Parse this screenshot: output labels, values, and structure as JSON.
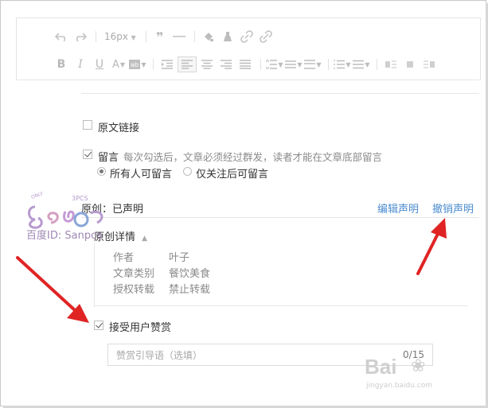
{
  "toolbar": {
    "font_size": "16px",
    "row1_icons": [
      "undo-icon",
      "redo-icon",
      "quote-icon",
      "horizontal-rule-icon",
      "format-painter-icon",
      "clear-format-icon",
      "link-icon",
      "unlink-icon"
    ],
    "row2_icons": [
      "bold-icon",
      "italic-icon",
      "underline-icon",
      "font-color-icon",
      "background-color-icon",
      "indent-icon",
      "align-left-icon",
      "align-center-icon",
      "align-right-icon",
      "align-justify-icon",
      "line-height-icon",
      "letter-spacing-icon",
      "paragraph-spacing-icon",
      "ordered-list-icon",
      "unordered-list-icon",
      "float-left-icon",
      "float-center-icon",
      "float-right-icon"
    ]
  },
  "original_link": {
    "label": "原文链接",
    "checked": false
  },
  "comments": {
    "label": "留言",
    "hint": "每次勾选后，文章必须经过群发，读者才能在文章底部留言",
    "checked": true,
    "options": [
      {
        "label": "所有人可留言",
        "selected": true
      },
      {
        "label": "仅关注后可留言",
        "selected": false
      }
    ]
  },
  "original": {
    "title": "原创：已声明",
    "edit_link": "编辑声明",
    "revoke_link": "撤销声明",
    "details_toggle": "原创详情",
    "details": [
      {
        "key": "作者",
        "value": "叶子"
      },
      {
        "key": "文章类别",
        "value": "餐饮美食"
      },
      {
        "key": "授权转载",
        "value": "禁止转载"
      }
    ]
  },
  "reward": {
    "label": "接受用户赞赏",
    "checked": true,
    "placeholder": "赞赏引导语（选填）",
    "counter": "0/15"
  },
  "watermark": {
    "text": "百度ID: Sanpcs",
    "logo_text": "3PCS",
    "logo_small": "ONLY",
    "baidu_text": "Bai",
    "baidu_sub": "jingyan.baidu.com"
  },
  "colors": {
    "link": "#4b8ccf",
    "arrow": "#e02424",
    "watermark": "#a38bbf"
  }
}
